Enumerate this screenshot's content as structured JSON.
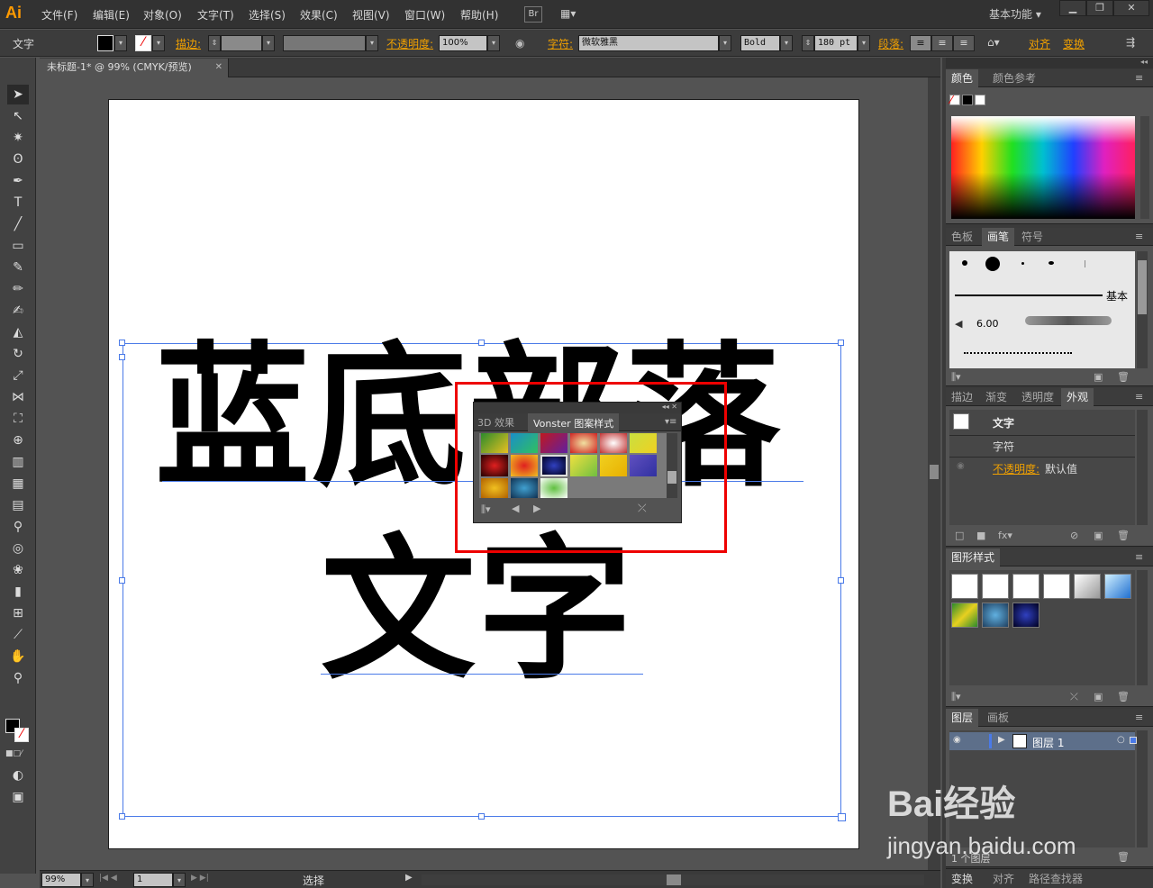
{
  "app": {
    "logo": "Ai",
    "workspace": "基本功能"
  },
  "menu": [
    "文件(F)",
    "编辑(E)",
    "对象(O)",
    "文字(T)",
    "选择(S)",
    "效果(C)",
    "视图(V)",
    "窗口(W)",
    "帮助(H)"
  ],
  "menu_extras": {
    "bridge": "Br"
  },
  "control": {
    "mode": "文字",
    "stroke_label": "描边:",
    "opacity_label": "不透明度:",
    "opacity_value": "100%",
    "char_label": "字符:",
    "font": "微软雅黑",
    "style": "Bold",
    "size": "180 pt",
    "para_label": "段落:",
    "align_label": "对齐",
    "transform_label": "变换"
  },
  "document": {
    "tab_title": "未标题-1* @ 99% (CMYK/预览)",
    "close": "✕"
  },
  "artwork": {
    "line1": "蓝底部落",
    "line2": "文字"
  },
  "pattern_panel": {
    "tab_inactive": "3D 效果",
    "tab_active": "Vonster 图案样式"
  },
  "status": {
    "zoom": "99%",
    "page": "1",
    "tool": "选择"
  },
  "color_panel": {
    "tab1": "颜色",
    "tab2": "颜色参考"
  },
  "brush_panel": {
    "tab1": "色板",
    "tab2": "画笔",
    "tab3": "符号",
    "basic": "基本",
    "size": "6.00"
  },
  "appearance_panel": {
    "tabs": [
      "描边",
      "渐变",
      "透明度",
      "外观"
    ],
    "title": "文字",
    "char": "字符",
    "opacity_label": "不透明度:",
    "opacity_value": "默认值"
  },
  "graphic_styles": {
    "title": "图形样式"
  },
  "layers_panel": {
    "tab1": "图层",
    "tab2": "画板",
    "layer": "图层 1",
    "count": "1 个图层"
  },
  "bottom_tabs": [
    "变换",
    "对齐",
    "路径查找器"
  ],
  "watermark": {
    "brand": "Bai经验",
    "url": "jingyan.baidu.com"
  },
  "colors": {
    "accent": "#f0a000",
    "highlight": "#e00000",
    "selection": "#4a7ae8"
  }
}
